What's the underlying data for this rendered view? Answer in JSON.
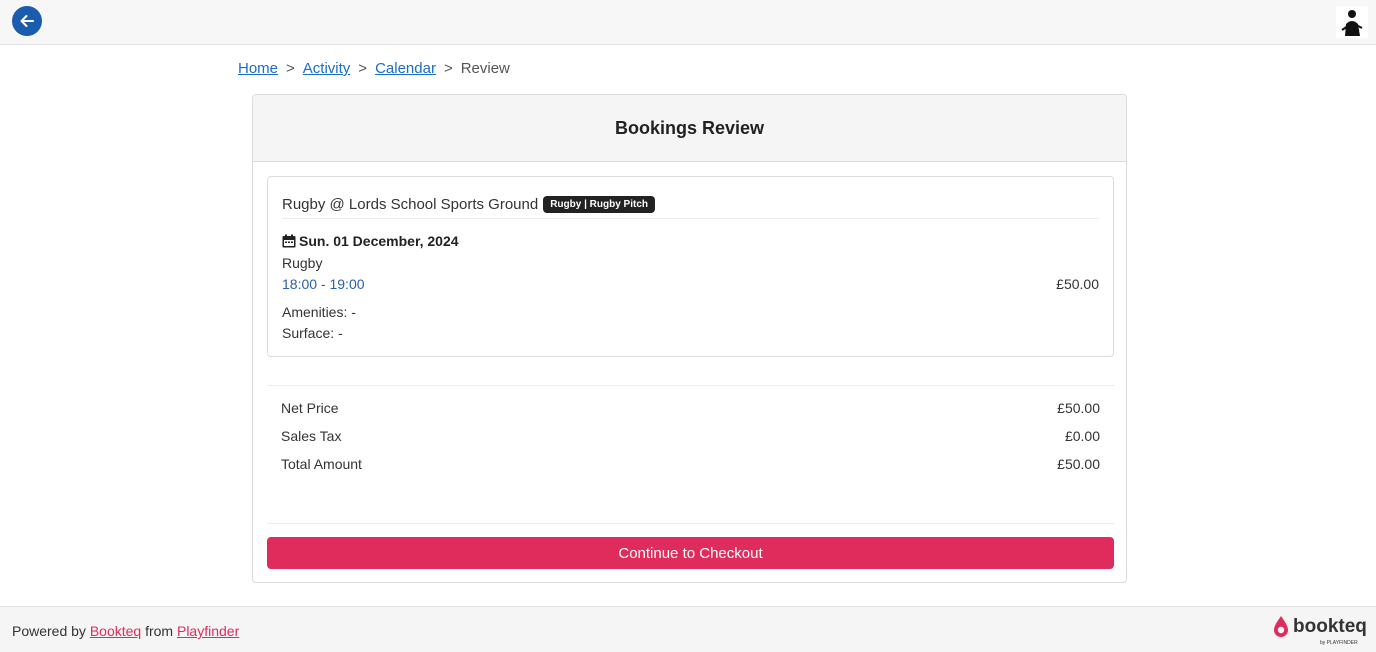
{
  "header": {
    "back_icon": "arrow-left-icon",
    "avatar_icon": "user-avatar-icon"
  },
  "breadcrumb": {
    "items": [
      {
        "label": "Home"
      },
      {
        "label": "Activity"
      },
      {
        "label": "Calendar"
      }
    ],
    "current": "Review",
    "separator": ">"
  },
  "card": {
    "title": "Bookings Review"
  },
  "booking": {
    "venue": "Rugby @ Lords School Sports Ground",
    "tag": "Rugby | Rugby Pitch",
    "date": "Sun. 01 December, 2024",
    "sport": "Rugby",
    "time": "18:00 - 19:00",
    "price": "£50.00",
    "amenities": "Amenities: -",
    "surface": "Surface: -"
  },
  "summary": {
    "net_label": "Net Price",
    "net_value": "£50.00",
    "tax_label": "Sales Tax",
    "tax_value": "£0.00",
    "total_label": "Total Amount",
    "total_value": "£50.00"
  },
  "checkout_label": "Continue to Checkout",
  "footer": {
    "powered_by": "Powered by",
    "bookteq_link": "Bookteq",
    "from": "from",
    "playfinder_link": "Playfinder",
    "logo_text": "bookteq",
    "logo_sub": "by PLAYFINDER"
  },
  "colors": {
    "primary": "#1a5cad",
    "accent": "#e02b5d",
    "link": "#1a6dc9"
  }
}
